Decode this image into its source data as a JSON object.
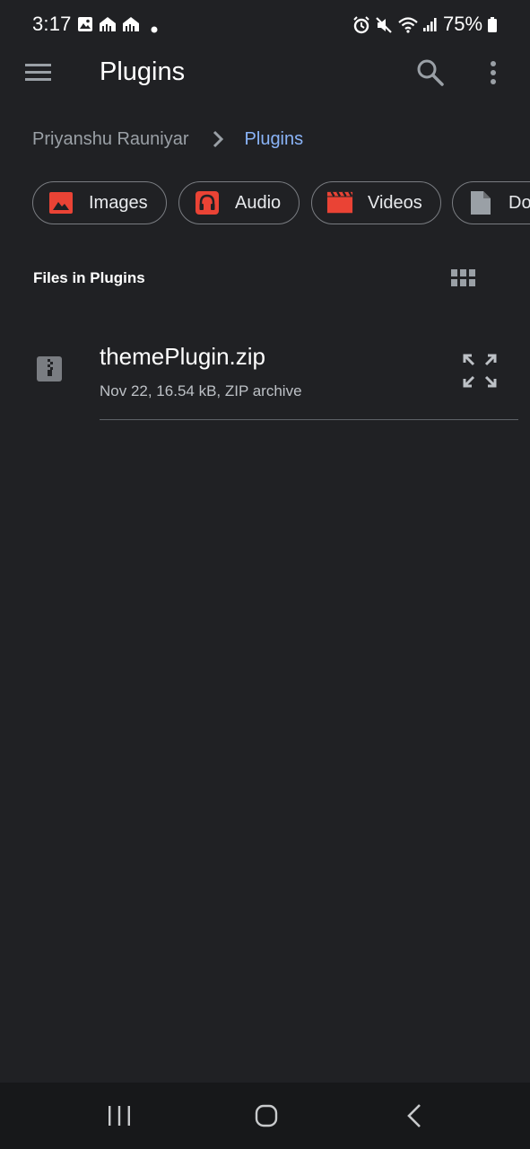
{
  "status_bar": {
    "time": "3:17",
    "battery": "75%",
    "left_icons": [
      "gallery-icon",
      "network-icon",
      "network-icon",
      "dot-icon"
    ],
    "right_icons": [
      "alarm-icon",
      "mute-icon",
      "wifi-icon",
      "signal-icon",
      "battery-icon"
    ]
  },
  "app_bar": {
    "title": "Plugins"
  },
  "breadcrumb": {
    "root": "Priyanshu Rauniyar",
    "current": "Plugins"
  },
  "chips": [
    {
      "label": "Images",
      "icon": "image-icon"
    },
    {
      "label": "Audio",
      "icon": "headphones-icon"
    },
    {
      "label": "Videos",
      "icon": "movie-icon"
    },
    {
      "label": "Do",
      "icon": "document-icon"
    }
  ],
  "section": {
    "title": "Files in Plugins",
    "view_toggle_icon": "grid-view-icon"
  },
  "files": [
    {
      "name": "themePlugin.zip",
      "meta": "Nov 22, 16.54 kB, ZIP archive",
      "icon": "zip-file-icon"
    }
  ],
  "colors": {
    "background": "#202124",
    "accent": "#8ab4f8",
    "chip_icon_red": "#ea4335",
    "chip_icon_gray": "#9aa0a6"
  }
}
